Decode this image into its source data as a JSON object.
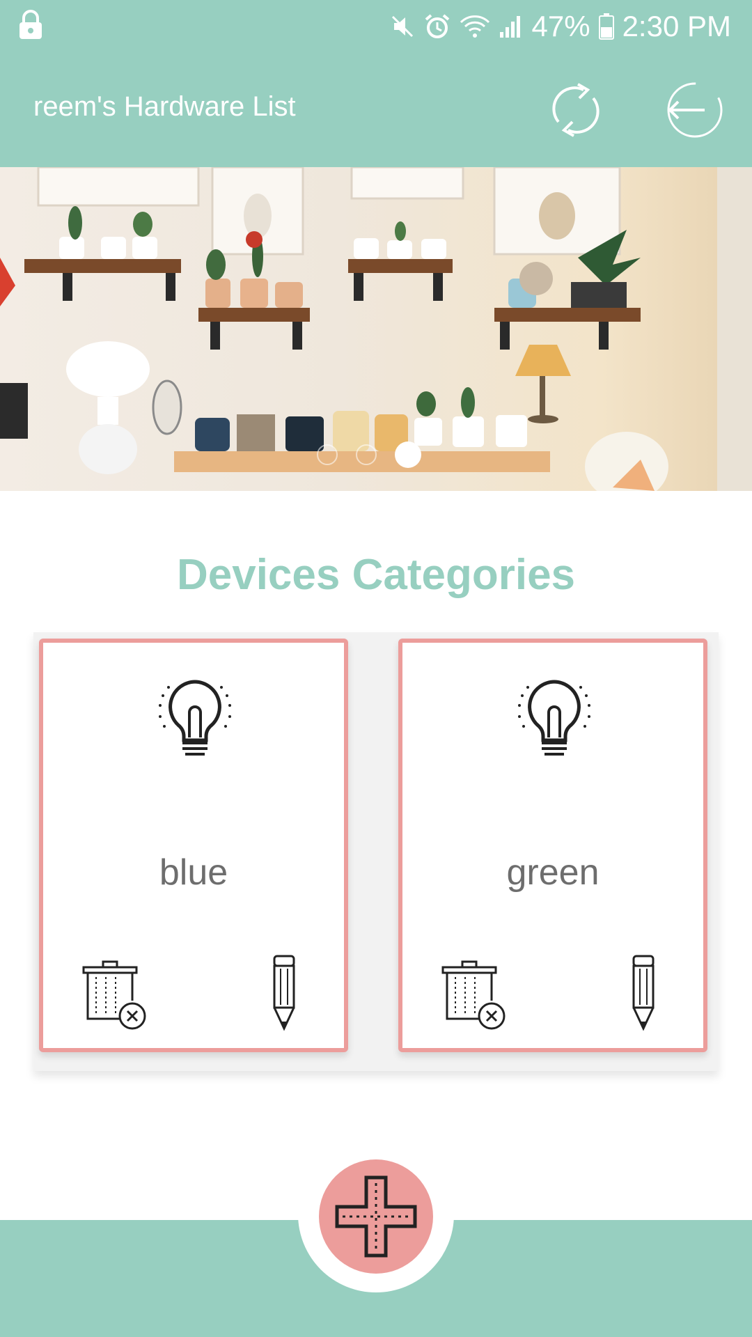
{
  "status_bar": {
    "battery": "47%",
    "time": "2:30 PM",
    "icons": [
      "lock-icon",
      "mute-icon",
      "alarm-icon",
      "wifi-icon",
      "signal-icon",
      "battery-icon"
    ]
  },
  "app_bar": {
    "title": "reem's Hardware List",
    "actions": [
      "refresh-icon",
      "logout-icon"
    ]
  },
  "banner": {
    "image": "shelves-with-plants-photo",
    "pages": 3,
    "active_page": 3
  },
  "section": {
    "title": "Devices Categories"
  },
  "categories": [
    {
      "label": "blue",
      "icon": "lightbulb-icon"
    },
    {
      "label": "green",
      "icon": "lightbulb-icon"
    }
  ],
  "fab": {
    "icon": "plus-icon"
  },
  "colors": {
    "primary": "#97cfc0",
    "accent": "#ec9d9b",
    "text": "#6d6d6d"
  }
}
